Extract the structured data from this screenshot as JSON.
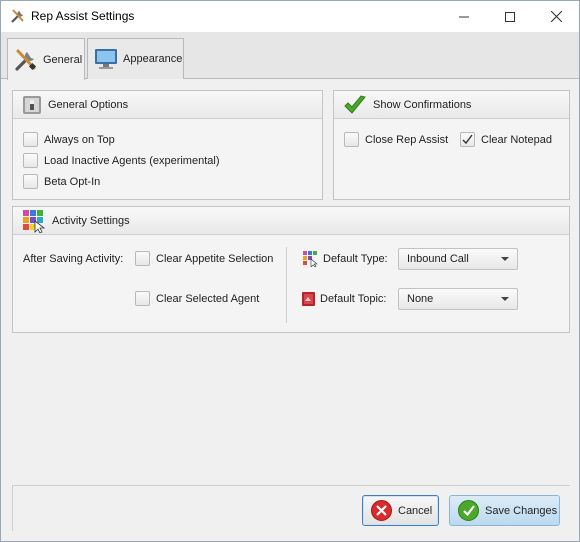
{
  "window": {
    "title": "Rep Assist Settings"
  },
  "tabs": [
    {
      "label": "General",
      "icon": "tools-icon",
      "active": true
    },
    {
      "label": "Appearance",
      "icon": "monitor-icon",
      "active": false
    }
  ],
  "general_options": {
    "title": "General Options",
    "items": [
      {
        "label": "Always on Top",
        "checked": false
      },
      {
        "label": "Load Inactive Agents (experimental)",
        "checked": false
      },
      {
        "label": "Beta Opt-In",
        "checked": false
      }
    ]
  },
  "show_confirmations": {
    "title": "Show Confirmations",
    "items": [
      {
        "label": "Close Rep Assist",
        "checked": false
      },
      {
        "label": "Clear Notepad",
        "checked": true
      }
    ]
  },
  "activity_settings": {
    "title": "Activity Settings",
    "after_saving_label": "After Saving Activity:",
    "items": [
      {
        "label": "Clear Appetite Selection",
        "checked": false
      },
      {
        "label": "Clear Selected Agent",
        "checked": false
      }
    ],
    "default_type_label": "Default Type:",
    "default_type_value": "Inbound Call",
    "default_topic_label": "Default Topic:",
    "default_topic_value": "None"
  },
  "buttons": {
    "cancel": "Cancel",
    "save": "Save Changes"
  },
  "colors": {
    "accent": "#3d7ec7",
    "check_green": "#4aa82b",
    "cancel_red": "#d92b2b"
  }
}
